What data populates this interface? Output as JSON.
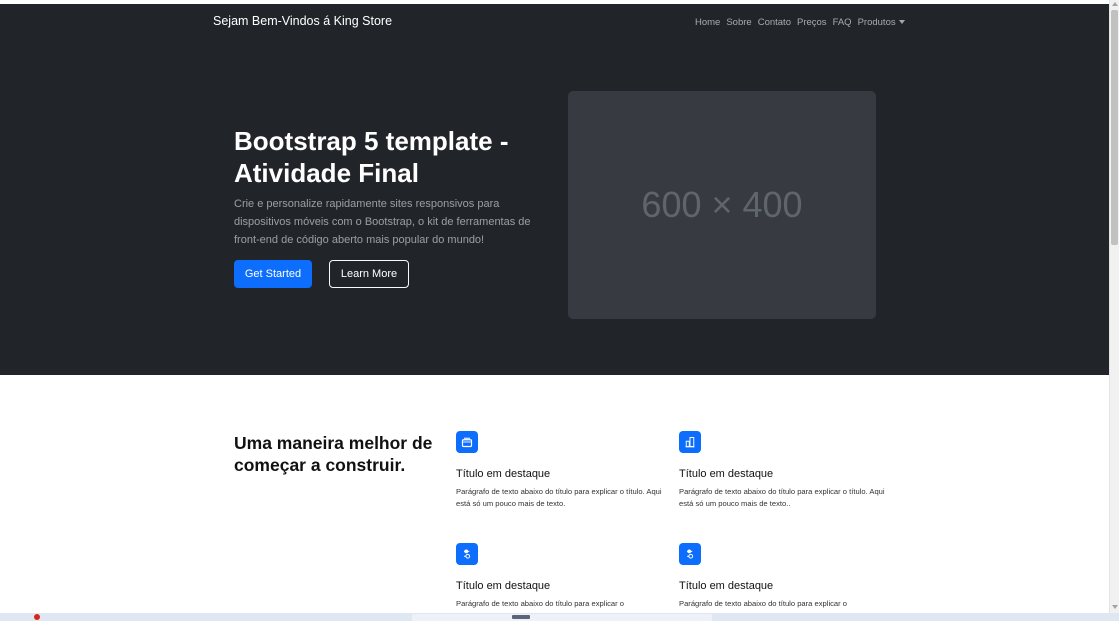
{
  "navbar": {
    "brand": "Sejam Bem-Vindos á King Store",
    "links": [
      "Home",
      "Sobre",
      "Contato",
      "Preços",
      "FAQ",
      "Produtos"
    ]
  },
  "hero": {
    "title": "Bootstrap 5 template - Atividade Final",
    "lead": "Crie e personalize rapidamente sites responsivos para dispositivos móveis com o Bootstrap, o kit de ferramentas de front-end de código aberto mais popular do mundo!",
    "primary_button": "Get Started",
    "secondary_button": "Learn More",
    "placeholder_text": "600 × 400"
  },
  "features": {
    "heading": "Uma maneira melhor de começar a construir.",
    "items": [
      {
        "icon": "collection-icon",
        "title": "Título em destaque",
        "text": "Parágrafo de texto abaixo do título para explicar o título. Aqui está só um pouco mais de texto."
      },
      {
        "icon": "building-icon",
        "title": "Título em destaque",
        "text": "Parágrafo de texto abaixo do título para explicar o título. Aqui está só um pouco mais de texto.."
      },
      {
        "icon": "toggles-icon",
        "title": "Título em destaque",
        "text": "Parágrafo de texto abaixo do título para explicar o"
      },
      {
        "icon": "toggles-icon",
        "title": "Título em destaque",
        "text": "Parágrafo de texto abaixo do título para explicar o"
      }
    ]
  },
  "colors": {
    "dark": "#212529",
    "primary": "#0d6efd",
    "placeholder": "#373b41"
  }
}
